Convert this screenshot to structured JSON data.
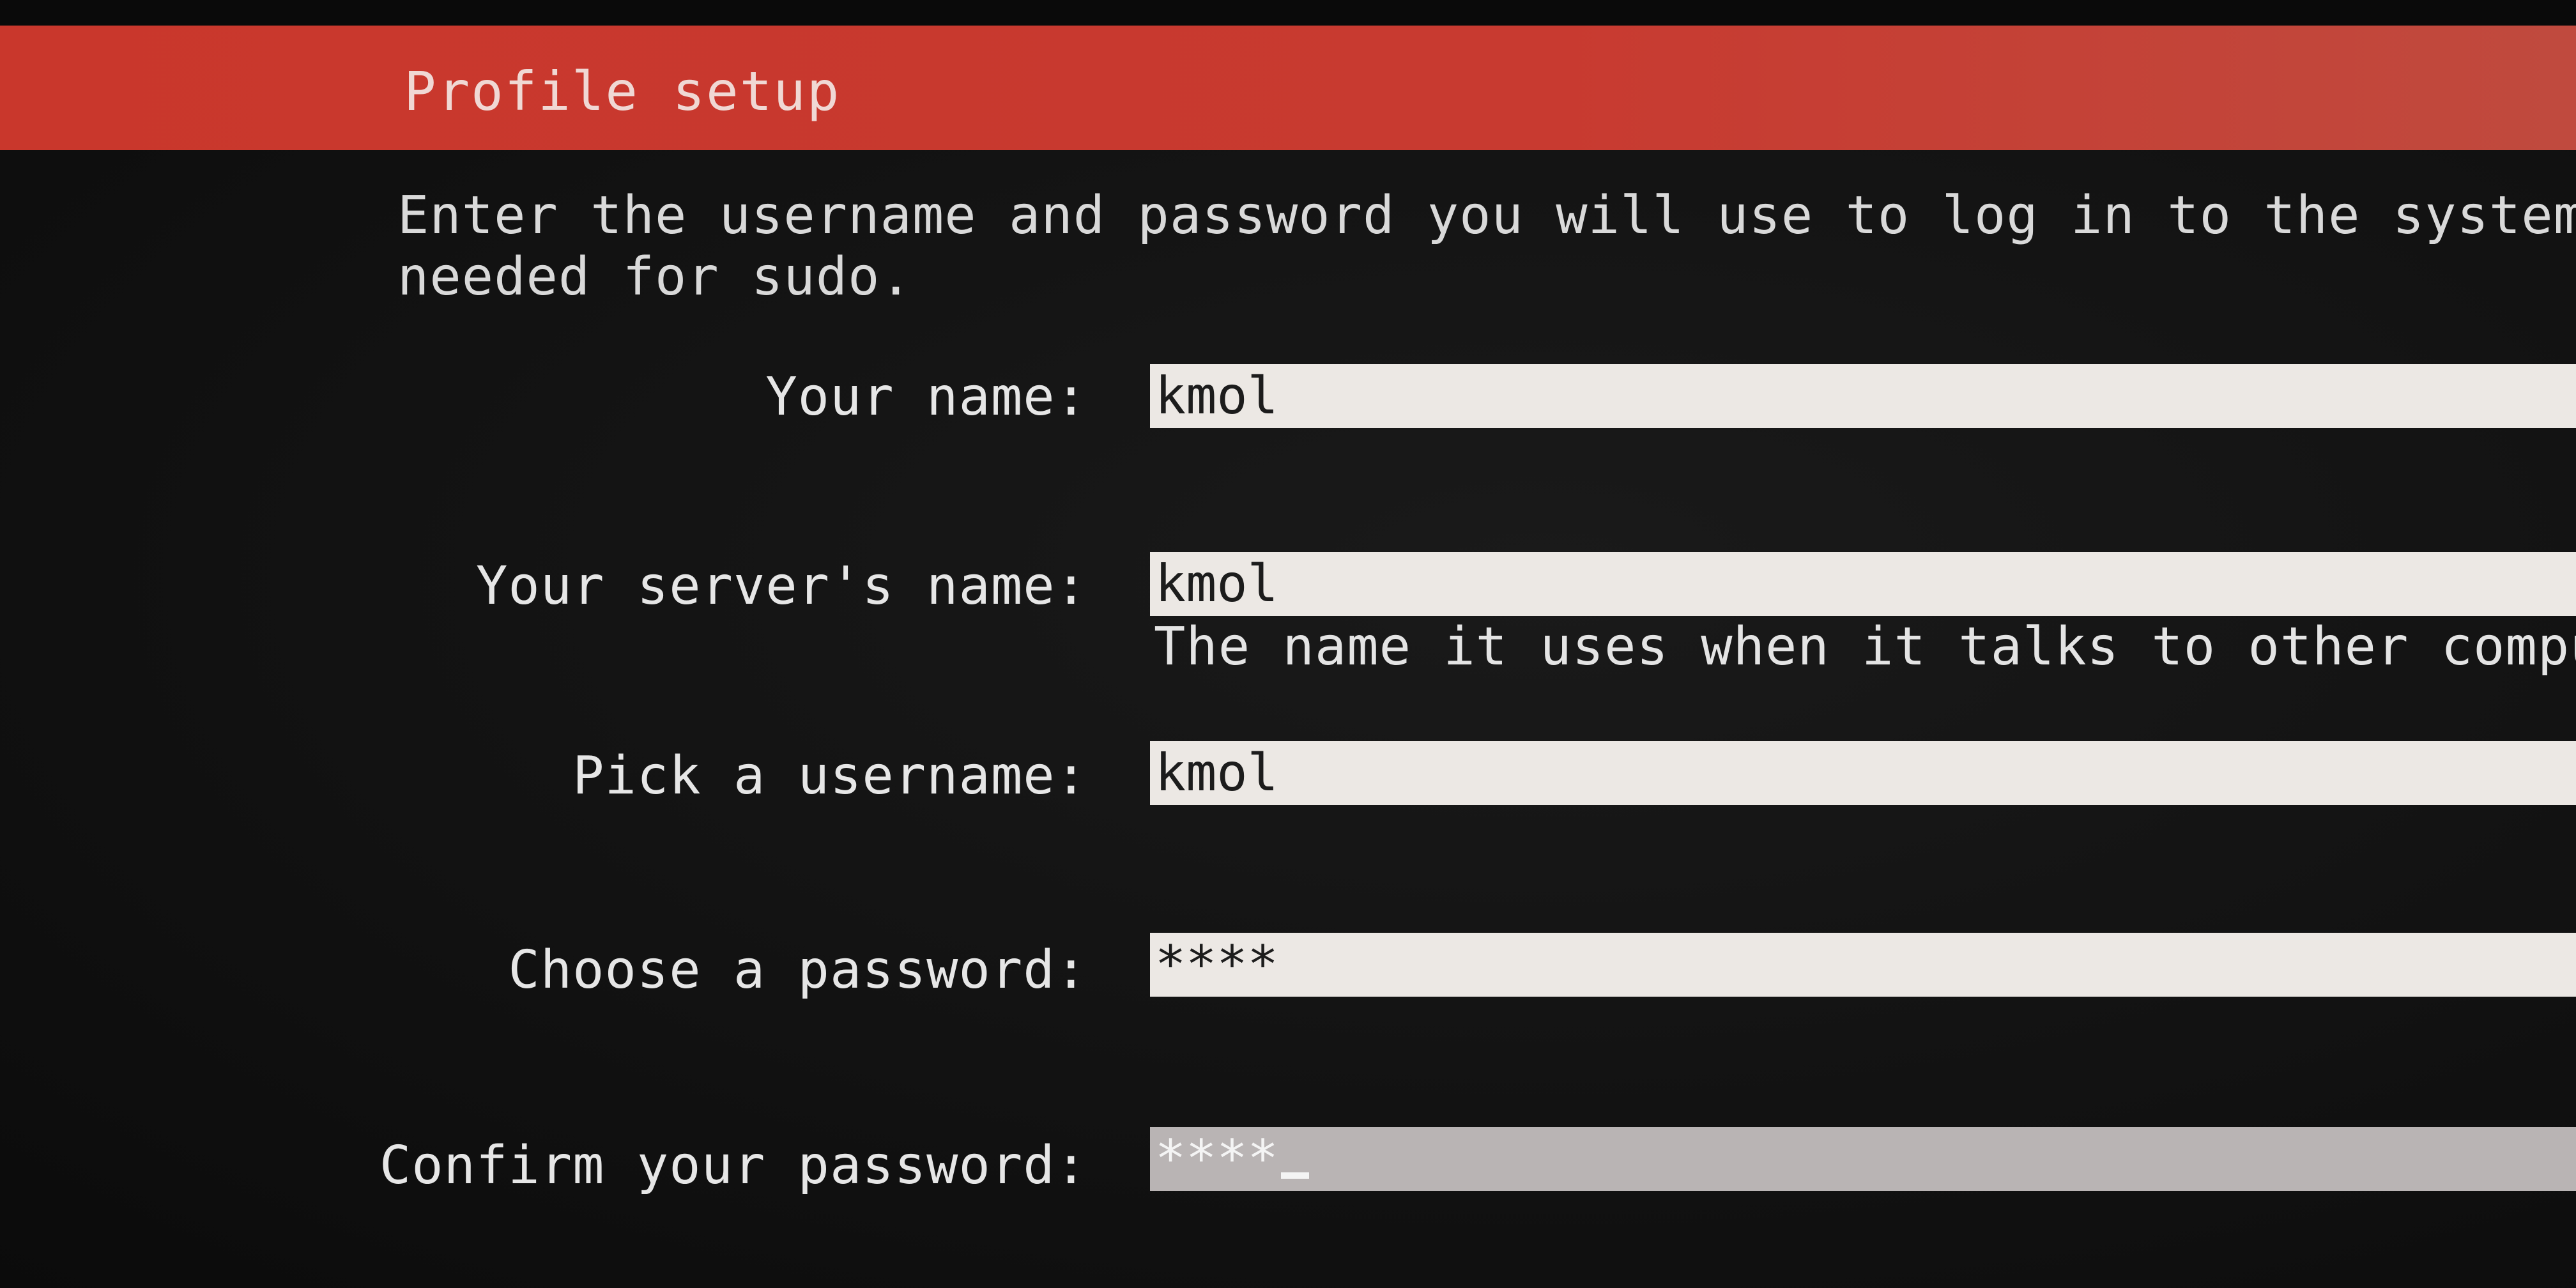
{
  "header": {
    "title": "Profile setup"
  },
  "intro": {
    "line1": "Enter the username and password you will use to log in to the system.",
    "line2": "needed for sudo."
  },
  "form": {
    "your_name": {
      "label": "Your name:",
      "value": "kmol"
    },
    "server_name": {
      "label": "Your server's name:",
      "value": "kmol",
      "hint": "The name it uses when it talks to other comput"
    },
    "username": {
      "label": "Pick a username:",
      "value": "kmol"
    },
    "password": {
      "label": "Choose a password:",
      "value": "****"
    },
    "confirm_password": {
      "label": "Confirm your password:",
      "value": "****"
    }
  },
  "colors": {
    "header_bar": "#c9372c",
    "background": "#121212",
    "field_bg": "#ece8e4",
    "focused_field_bg": "#b9b4b4"
  }
}
